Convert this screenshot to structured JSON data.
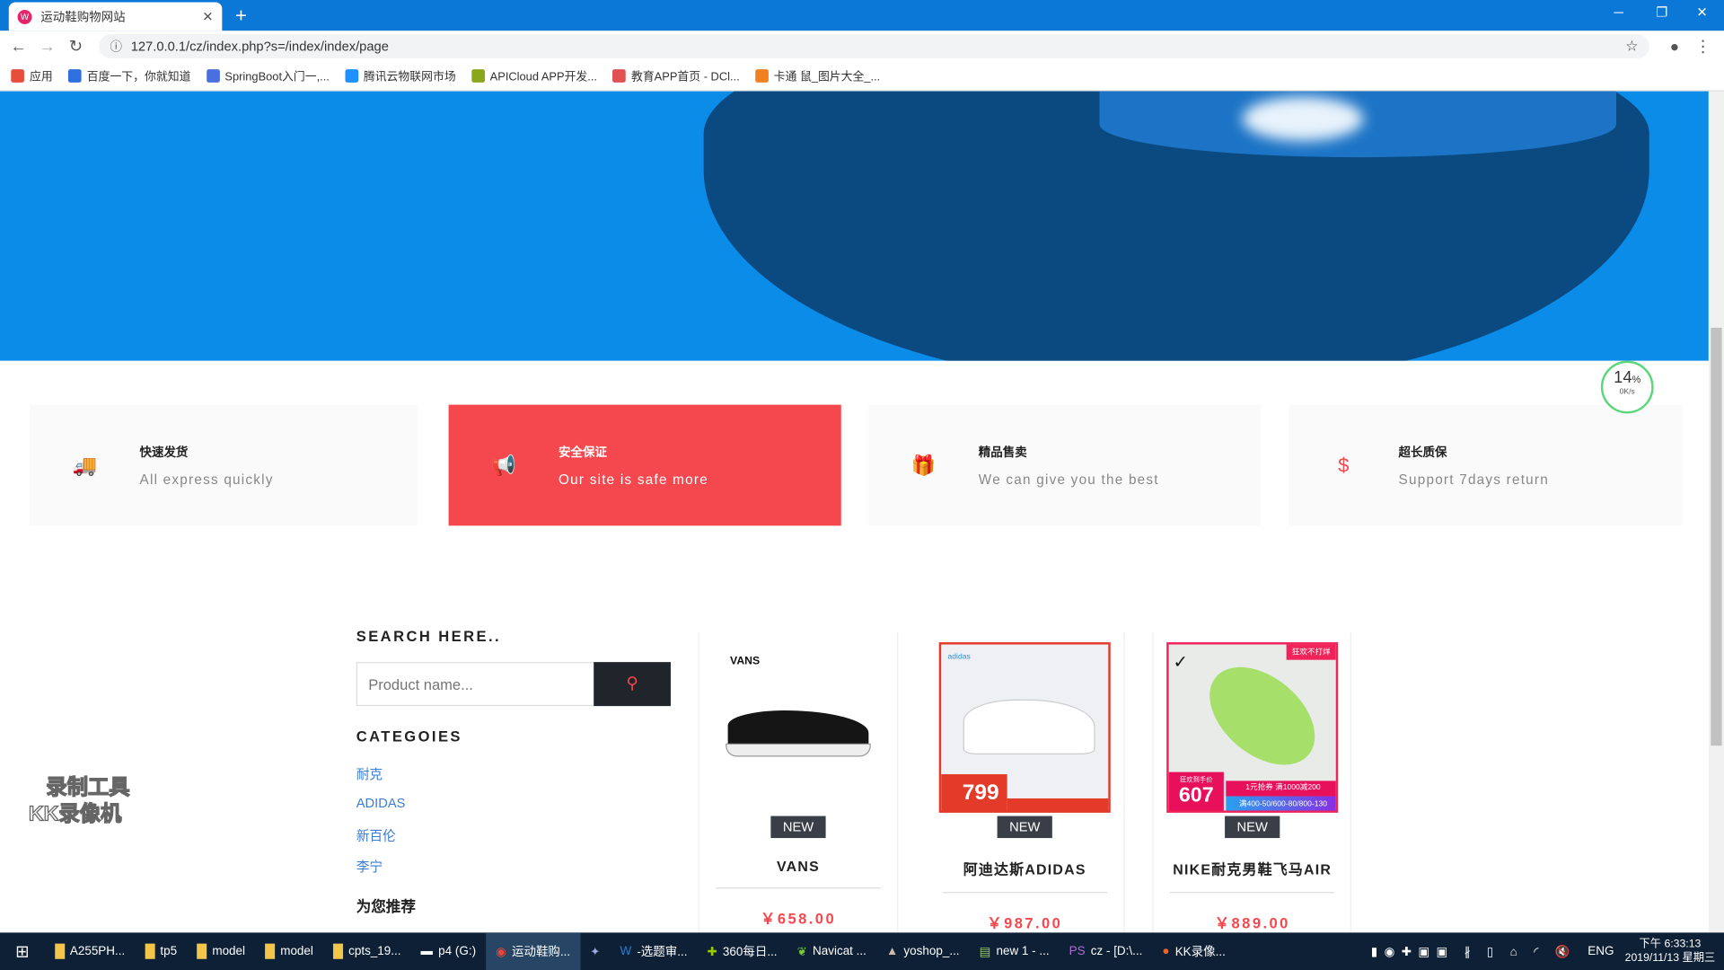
{
  "browser": {
    "tab_title": "运动鞋购物网站",
    "url": "127.0.0.1/cz/index.php?s=/index/index/page",
    "bookmarks": [
      {
        "label": "应用",
        "color": "#e74c3c"
      },
      {
        "label": "百度一下，你就知道",
        "color": "#2f6fe0"
      },
      {
        "label": "SpringBoot入门一,...",
        "color": "#4a6fe0"
      },
      {
        "label": "腾讯云物联网市场",
        "color": "#1e90ff"
      },
      {
        "label": "APICloud APP开发...",
        "color": "#8aa61b"
      },
      {
        "label": "教育APP首页 - DCl...",
        "color": "#e05050"
      },
      {
        "label": "卡通 鼠_图片大全_...",
        "color": "#f08020"
      }
    ]
  },
  "speed": {
    "percent": "14",
    "unit": "%",
    "rate": "0K/s"
  },
  "features": [
    {
      "title": "快速发货",
      "subtitle": "All express quickly",
      "icon": "truck-icon",
      "glyph": "🚚"
    },
    {
      "title": "安全保证",
      "subtitle": "Our site is safe more",
      "icon": "megaphone-icon",
      "glyph": "📢"
    },
    {
      "title": "精品售卖",
      "subtitle": "We can give you the best",
      "icon": "gift-icon",
      "glyph": "🎁"
    },
    {
      "title": "超长质保",
      "subtitle": "Support 7days return",
      "icon": "dollar-icon",
      "glyph": "$"
    }
  ],
  "sidebar": {
    "search_title": "SEARCH HERE..",
    "search_placeholder": "Product name...",
    "categories_title": "CATEGOIES",
    "categories": [
      "耐克",
      "ADIDAS",
      "新百伦",
      "李宁"
    ],
    "recommend_title": "为您推荐"
  },
  "products": [
    {
      "name": "VANS",
      "price": "￥658.00",
      "badge": "NEW",
      "brand": "VANS"
    },
    {
      "name": "阿迪达斯ADIDAS",
      "price": "￥987.00",
      "badge": "NEW",
      "brand": "adidas",
      "promo_price": "799"
    },
    {
      "name": "NIKE耐克男鞋飞马AIR",
      "price": "￥889.00",
      "badge": "NEW",
      "promo_price": "607",
      "promo_tag": "狂欢不打烊",
      "promo_label": "狂欢到手价",
      "promo_line1": "1元抢券 满1000减200",
      "promo_line2": "满400-50/600-80/800-130"
    }
  ],
  "watermark": [
    "录制工具",
    "KK录像机"
  ],
  "taskbar": {
    "items": [
      "A255PH...",
      "tp5",
      "model",
      "model",
      "cpts_19...",
      "p4 (G:)",
      "运动鞋购...",
      "",
      "-选题审...",
      "360每日...",
      "Navicat ...",
      "yoshop_...",
      "new 1 - ...",
      "cz - [D:\\...",
      "KK录像..."
    ],
    "lang": "ENG",
    "time": "下午 6:33:13",
    "date": "2019/11/13 星期三"
  }
}
